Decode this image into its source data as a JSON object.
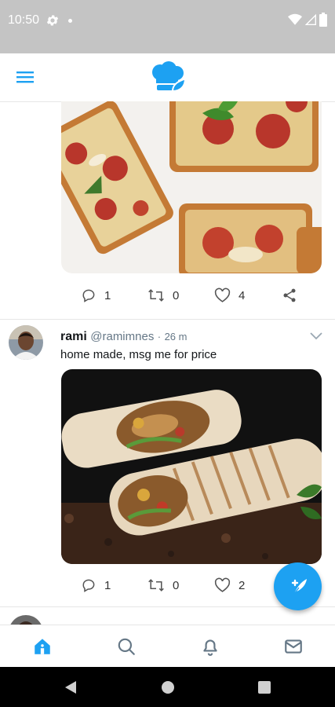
{
  "status_bar": {
    "time": "10:50",
    "icons": [
      "gear-icon",
      "notification-dot-icon",
      "wifi-icon",
      "cell-signal-icon",
      "battery-icon"
    ]
  },
  "app_bar": {
    "menu_icon": "hamburger-menu-icon",
    "logo_icon": "chef-hat-leaf-logo"
  },
  "colors": {
    "accent": "#1da1f2",
    "status_bar_bg": "#c4c4c4",
    "nav_bar_bg": "#000000",
    "muted_text": "#657786"
  },
  "feed": [
    {
      "image": "pizza-toast-photo",
      "actions": {
        "replies": "1",
        "retweets": "0",
        "likes": "4"
      }
    },
    {
      "name": "rami",
      "handle": "@ramimnes",
      "separator": "·",
      "time": "26 m",
      "text": "home made, msg me for price",
      "image": "shawarma-wrap-photo",
      "actions": {
        "replies": "1",
        "retweets": "0",
        "likes": "2"
      }
    },
    {
      "name": "",
      "handle": "",
      "text": ""
    }
  ],
  "fab": {
    "icon": "compose-feather-plus-icon"
  },
  "bottom_nav": {
    "items": [
      "home-icon",
      "search-icon",
      "notifications-bell-icon",
      "messages-mail-icon"
    ],
    "active": "home-icon"
  },
  "system_nav": {
    "items": [
      "back-icon",
      "home-circle-icon",
      "recents-square-icon"
    ]
  }
}
